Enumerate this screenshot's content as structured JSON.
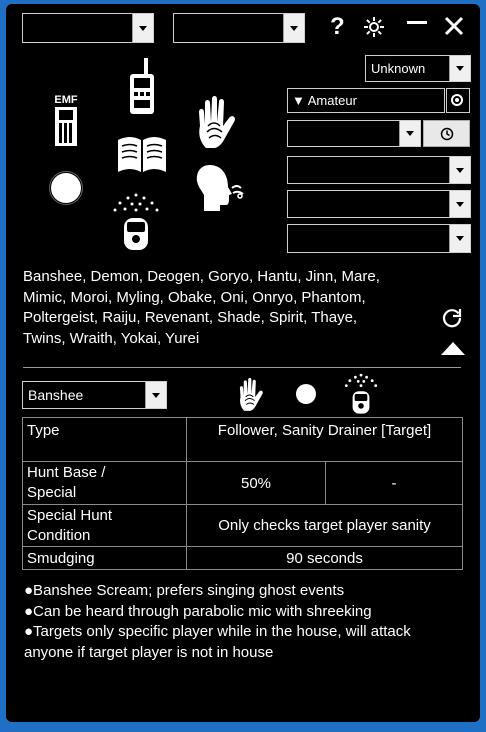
{
  "top_bar": {
    "combo1_value": "",
    "combo2_value": "",
    "help_icon": "question-mark",
    "settings_icon": "gear",
    "minimize_icon": "minimize",
    "close_icon": "close-x"
  },
  "evidence_icons": [
    {
      "name": "emf",
      "label": "EMF"
    },
    {
      "name": "spirit-box"
    },
    {
      "name": "fingerprints"
    },
    {
      "name": "ghost-writing"
    },
    {
      "name": "ghost-orb"
    },
    {
      "name": "freezing-breath"
    },
    {
      "name": "dots-projector"
    }
  ],
  "right_panel": {
    "speed_select": "Unknown",
    "difficulty_label": "▼ Amateur",
    "timer_combo_value": "",
    "combo_a_value": "",
    "combo_b_value": "",
    "combo_c_value": ""
  },
  "ghost_list": {
    "lines": [
      "Banshee, Demon, Deogen, Goryo, Hantu, Jinn, Mare,",
      "Mimic, Moroi, Myling, Obake, Oni, Onryo, Phantom,",
      "Poltergeist, Raiju, Revenant, Shade, Spirit, Thaye,",
      "Twins, Wraith, Yokai, Yurei"
    ]
  },
  "detail": {
    "ghost_select": "Banshee",
    "evidence": [
      "fingerprints",
      "ghost-orb",
      "dots-projector"
    ],
    "table": {
      "type_label": "Type",
      "type_value": "Follower, Sanity Drainer [Target]",
      "hunt_label_1": "Hunt Base /",
      "hunt_label_2": "Special",
      "hunt_base": "50%",
      "hunt_special": "-",
      "special_label_1": "Special Hunt",
      "special_label_2": "Condition",
      "special_value": "Only checks target player sanity",
      "smudging_label": "Smudging",
      "smudging_value": "90 seconds"
    },
    "notes": [
      "●Banshee Scream; prefers singing ghost events",
      "●Can be heard through parabolic mic with shreeking",
      "●Targets only specific player while in the house, will attack anyone if target player is not in house"
    ]
  }
}
